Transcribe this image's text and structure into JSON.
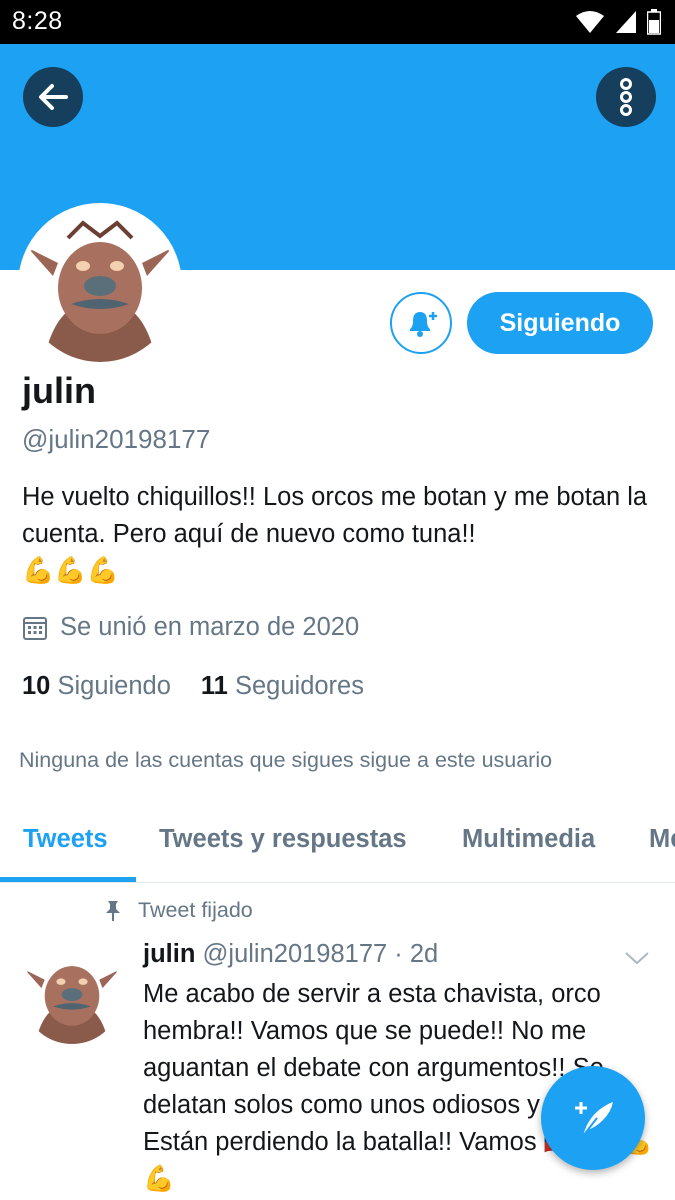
{
  "status_bar": {
    "time": "8:28"
  },
  "profile": {
    "name": "julin",
    "handle": "@julin20198177",
    "bio": "He vuelto chiquillos!! Los orcos me botan y me botan la cuenta. Pero aquí de nuevo como tuna!!",
    "bio_emoji": "💪💪💪",
    "joined": "Se unió en marzo de 2020",
    "following_count": "10",
    "following_label": "Siguiendo",
    "followers_count": "11",
    "followers_label": "Seguidores",
    "followed_by_note": "Ninguna de las cuentas que sigues sigue a este usuario"
  },
  "buttons": {
    "follow_state": "Siguiendo"
  },
  "tabs": [
    "Tweets",
    "Tweets y respuestas",
    "Multimedia",
    "Me"
  ],
  "pinned_label": "Tweet fijado",
  "tweet": {
    "name": "julin",
    "meta": "@julin20198177 · 2d",
    "text": "Me acabo de servir a esta chavista, orco hembra!! Vamos que se puede!! No me aguantan el debate con argumentos!! Se delatan solos como unos odiosos y tóxicos! Están perdiendo la batalla!! Vamos",
    "tail_flag": "🇨🇱",
    "tail": "!!💪💪💪"
  },
  "colors": {
    "brand": "#1da1f2",
    "dark_button": "#153f5c",
    "secondary_text": "#657786"
  },
  "icons": [
    "back-arrow-icon",
    "more-vertical-icon",
    "bell-plus-icon",
    "calendar-icon",
    "pin-icon",
    "chevron-down-icon",
    "compose-tweet-icon"
  ]
}
